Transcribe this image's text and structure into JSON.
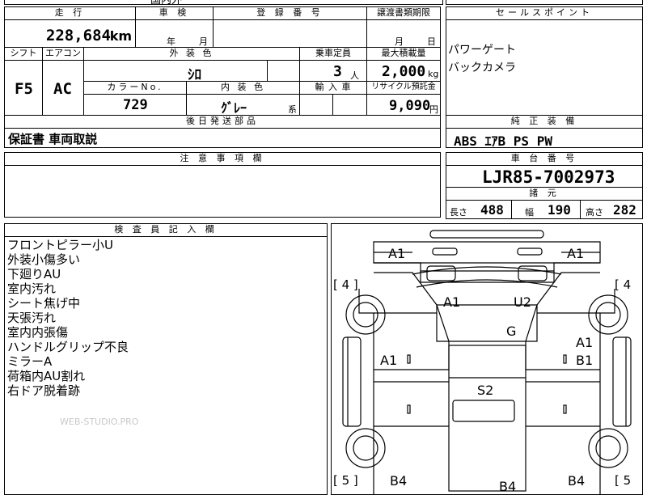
{
  "top": {
    "header_truncated": "国内外"
  },
  "mileage": {
    "label": "走 行",
    "value": "228,684",
    "unit": "km"
  },
  "inspection": {
    "label": "車 検",
    "year_unit": "年",
    "month_unit": "月"
  },
  "registration": {
    "label": "登 録 番 号",
    "value": ""
  },
  "transfer": {
    "label": "譲渡書類期限",
    "month_unit": "月",
    "day_unit": "日"
  },
  "sales_points": {
    "label": "セールスポイント",
    "items": [
      "パワーゲート",
      "バックカメラ"
    ]
  },
  "shift": {
    "label": "シフト",
    "value": "F5"
  },
  "aircon": {
    "label": "エアコン",
    "value": "AC"
  },
  "exterior_color": {
    "label": "外 装 色",
    "value": "ｼﾛ"
  },
  "capacity": {
    "label": "乗車定員",
    "value": "3",
    "unit": "人"
  },
  "max_load": {
    "label": "最大積載量",
    "value": "2,000",
    "unit": "kg"
  },
  "color_no": {
    "label": "カラーNo.",
    "value": "729"
  },
  "interior_color": {
    "label": "内 装 色",
    "value": "ｸﾞﾚｰ",
    "suffix": "系"
  },
  "import": {
    "label": "輸 入 車"
  },
  "recycle": {
    "label": "リサイクル預託金",
    "value": "9,090",
    "unit": "円"
  },
  "later_parts": {
    "label": "後日発送部品",
    "value": "保証書 車両取説"
  },
  "equipment": {
    "label": "純 正 装 備",
    "value": "ABS ｴｱB PS PW"
  },
  "notes": {
    "label": "注 意 事 項 欄",
    "value": ""
  },
  "chassis": {
    "label": "車 台 番 号",
    "value": "LJR85-7002973"
  },
  "specs": {
    "label": "諸 元",
    "length_label": "長さ",
    "length": "488",
    "width_label": "幅",
    "width": "190",
    "height_label": "高さ",
    "height": "282"
  },
  "inspector": {
    "label": "検 査 員 記 入 欄",
    "lines": [
      "フロントピラー小U",
      "外装小傷多い",
      "下廻りAU",
      "室内汚れ",
      "シート焦げ中",
      "天張汚れ",
      "室内内張傷",
      "ハンドルグリップ不良",
      "ミラーA",
      "荷箱内AU割れ",
      "右ドア脱着跡"
    ]
  },
  "watermark": "WEB-STUDIO.PRO",
  "diagram": {
    "tire_left_front": "[ 4 ]",
    "tire_right_front": "[ 4",
    "tire_left_rear": "[ 5 ]",
    "tire_right_rear": "[ 5",
    "marks": {
      "a1_top_left": "A1",
      "a1_top_right": "A1",
      "a1_cab_left": "A1",
      "u2_cab_right": "U2",
      "g_windshield": "G",
      "a1_door_left": "A1",
      "a1_door_right": "A1",
      "b1_door_right": "B1",
      "s2_floor": "S2",
      "b4_rear_left": "B4",
      "b4_rear_center": "B4",
      "b4_rear_right": "B4"
    }
  }
}
